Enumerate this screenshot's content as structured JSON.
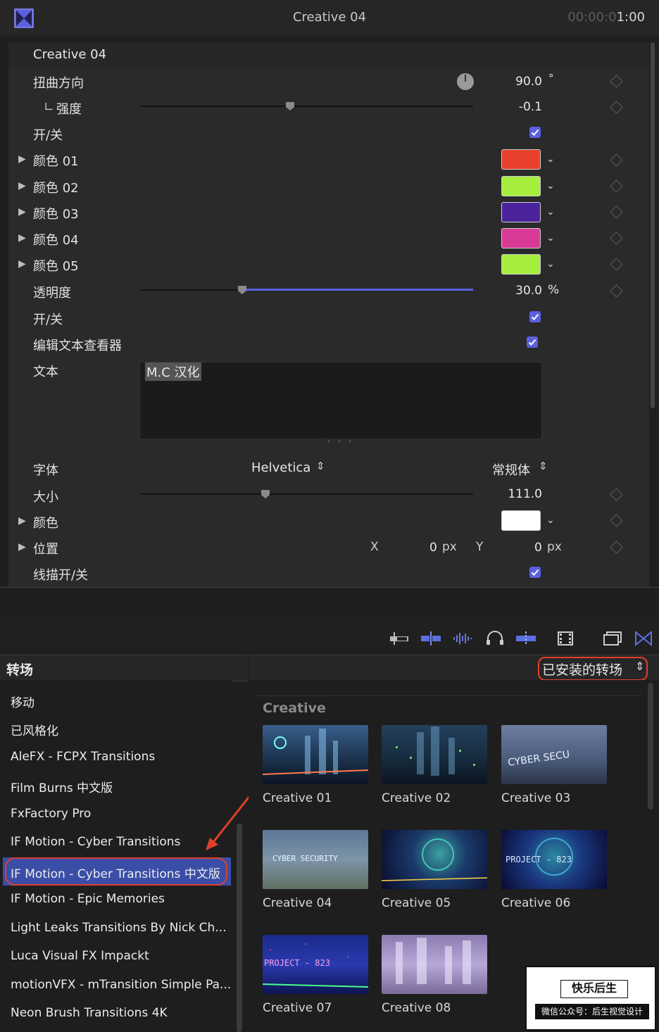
{
  "inspector": {
    "title": "Creative 04",
    "timecode_dim": "00:00:0",
    "timecode_bright": "1:00",
    "section_title": "Creative 04",
    "rows": {
      "warp_direction": {
        "label": "扭曲方向",
        "value": "90.0",
        "unit": "°"
      },
      "strength": {
        "label": "强度",
        "value": "-0.1",
        "level": -0.1
      },
      "toggle1": {
        "label": "开/关",
        "checked": true
      },
      "color01": {
        "label": "颜色 01",
        "color": "#e8402a"
      },
      "color02": {
        "label": "颜色 02",
        "color": "#a6ee3c"
      },
      "color03": {
        "label": "颜色 03",
        "color": "#4b239c"
      },
      "color04": {
        "label": "颜色 04",
        "color": "#d93a95"
      },
      "color05": {
        "label": "颜色 05",
        "color": "#a6ee3c"
      },
      "opacity": {
        "label": "透明度",
        "value": "30.0",
        "unit": "%",
        "level": 0.3
      },
      "toggle2": {
        "label": "开/关",
        "checked": true
      },
      "edit_text_viewer": {
        "label": "编辑文本查看器",
        "checked": true
      },
      "text": {
        "label": "文本",
        "value": "M.C 汉化"
      },
      "font": {
        "label": "字体",
        "family": "Helvetica",
        "style": "常规体"
      },
      "size": {
        "label": "大小",
        "value": "111.0",
        "level": 0.37
      },
      "color": {
        "label": "颜色",
        "color": "#ffffff"
      },
      "position": {
        "label": "位置",
        "x_label": "X",
        "x_value": "0",
        "x_unit": "px",
        "y_label": "Y",
        "y_value": "0",
        "y_unit": "px"
      },
      "stroke_toggle": {
        "label": "线描开/关",
        "checked": true
      }
    }
  },
  "browser": {
    "header_label": "转场",
    "filter": "已安装的转场",
    "categories": [
      "移动",
      "已风格化",
      "AleFX - FCPX Transitions",
      "Film Burns 中文版",
      "FxFactory Pro",
      "IF Motion - Cyber Transitions",
      "IF Motion - Cyber Transitions 中文版",
      "IF Motion - Epic Memories",
      "Light Leaks Transitions By Nick Ch...",
      "Luca Visual FX Impackt",
      "motionVFX - mTransition Simple Pa...",
      "Neon Brush Transitions 4K"
    ],
    "selected_index": 6,
    "group_title": "Creative",
    "items": [
      {
        "label": "Creative 01"
      },
      {
        "label": "Creative 02"
      },
      {
        "label": "Creative 03",
        "overlay": "CYBER SECU"
      },
      {
        "label": "Creative 04",
        "overlay": "CYBER SECURITY"
      },
      {
        "label": "Creative 05"
      },
      {
        "label": "Creative 06",
        "overlay": "PROJECT - 823"
      },
      {
        "label": "Creative 07",
        "overlay": "PROJECT - 823"
      },
      {
        "label": "Creative 08"
      }
    ]
  },
  "watermark": {
    "title": "快乐后生",
    "subtitle": "微信公众号：后生视觉设计"
  },
  "colors": {
    "accent": "#5b5fe0",
    "highlight_ring": "#e0402a",
    "selection": "#3a4ea8"
  }
}
